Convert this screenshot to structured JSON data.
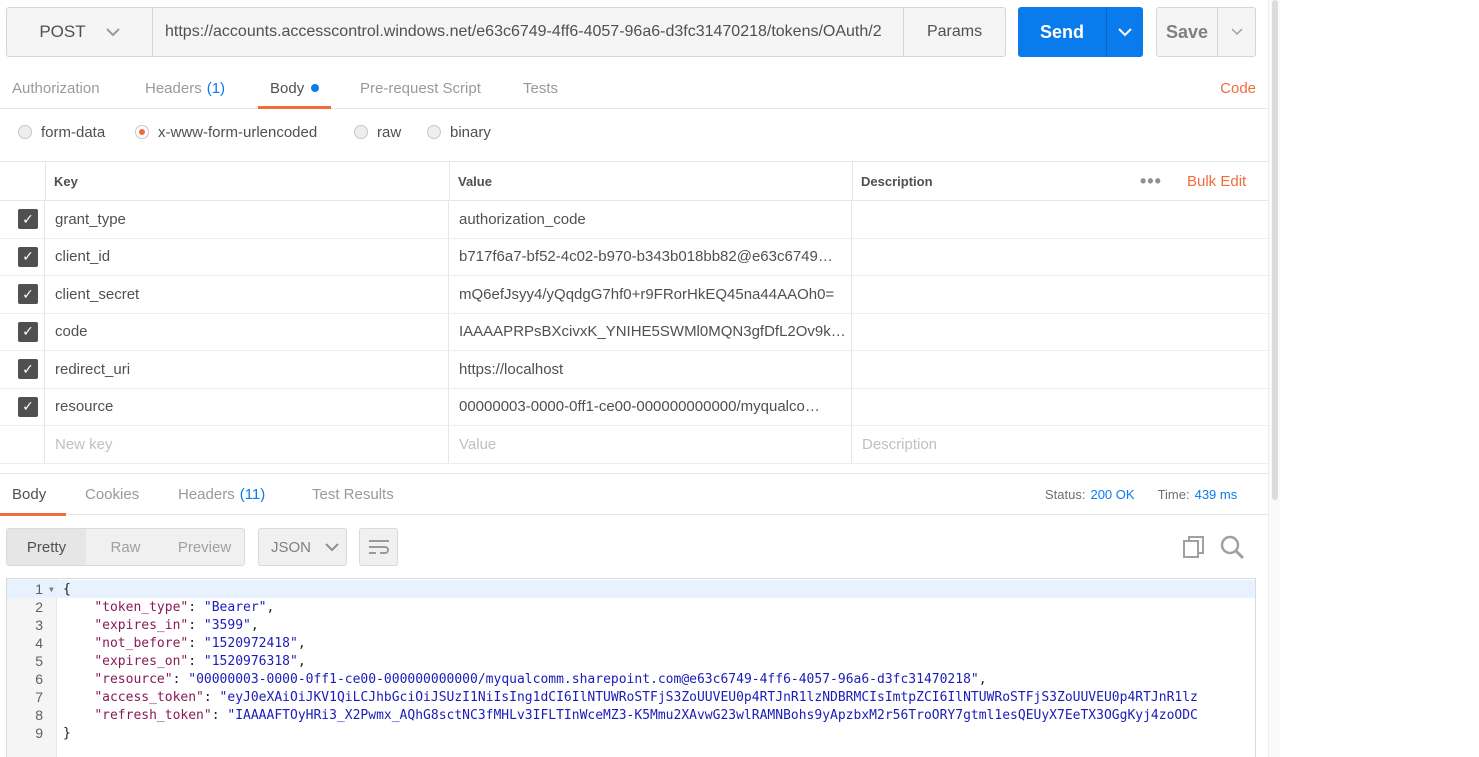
{
  "request": {
    "method": "POST",
    "url": "https://accounts.accesscontrol.windows.net/e63c6749-4ff6-4057-96a6-d3fc31470218/tokens/OAuth/2",
    "params_label": "Params",
    "send_label": "Send",
    "save_label": "Save"
  },
  "req_tabs": {
    "authorization": "Authorization",
    "headers": "Headers",
    "headers_count": "(1)",
    "body": "Body",
    "prerequest": "Pre-request Script",
    "tests": "Tests",
    "code": "Code"
  },
  "body_types": {
    "form_data": "form-data",
    "urlencoded": "x-www-form-urlencoded",
    "raw": "raw",
    "binary": "binary",
    "selected": "x-www-form-urlencoded"
  },
  "kv_table": {
    "headers": {
      "key": "Key",
      "value": "Value",
      "description": "Description"
    },
    "more": "•••",
    "bulk_edit": "Bulk Edit",
    "rows": [
      {
        "key": "grant_type",
        "value": "authorization_code",
        "checked": true
      },
      {
        "key": "client_id",
        "value": "b717f6a7-bf52-4c02-b970-b343b018bb82@e63c6749…",
        "checked": true
      },
      {
        "key": "client_secret",
        "value": "mQ6efJsyy4/yQqdgG7hf0+r9FRorHkEQ45na44AAOh0=",
        "checked": true
      },
      {
        "key": "code",
        "value": "IAAAAPRPsBXcivxK_YNIHE5SWMl0MQN3gfDfL2Ov9k…",
        "checked": true
      },
      {
        "key": "redirect_uri",
        "value": "https://localhost",
        "checked": true
      },
      {
        "key": "resource",
        "value": "00000003-0000-0ff1-ce00-000000000000/myqualco…",
        "checked": true
      }
    ],
    "new_row": {
      "key": "New key",
      "value": "Value",
      "description": "Description"
    }
  },
  "resp_tabs": {
    "body": "Body",
    "cookies": "Cookies",
    "headers": "Headers",
    "headers_count": "(11)",
    "test_results": "Test Results",
    "status_label": "Status:",
    "status_value": "200 OK",
    "time_label": "Time:",
    "time_value": "439 ms"
  },
  "resp_toolbar": {
    "pretty": "Pretty",
    "raw": "Raw",
    "preview": "Preview",
    "format": "JSON"
  },
  "editor": {
    "lines": [
      {
        "n": "1",
        "parts": [
          [
            "p",
            "{"
          ]
        ]
      },
      {
        "n": "2",
        "parts": [
          [
            "p",
            "    "
          ],
          [
            "k",
            "\"token_type\""
          ],
          [
            "p",
            ": "
          ],
          [
            "s",
            "\"Bearer\""
          ],
          [
            "p",
            ","
          ]
        ]
      },
      {
        "n": "3",
        "parts": [
          [
            "p",
            "    "
          ],
          [
            "k",
            "\"expires_in\""
          ],
          [
            "p",
            ": "
          ],
          [
            "s",
            "\"3599\""
          ],
          [
            "p",
            ","
          ]
        ]
      },
      {
        "n": "4",
        "parts": [
          [
            "p",
            "    "
          ],
          [
            "k",
            "\"not_before\""
          ],
          [
            "p",
            ": "
          ],
          [
            "s",
            "\"1520972418\""
          ],
          [
            "p",
            ","
          ]
        ]
      },
      {
        "n": "5",
        "parts": [
          [
            "p",
            "    "
          ],
          [
            "k",
            "\"expires_on\""
          ],
          [
            "p",
            ": "
          ],
          [
            "s",
            "\"1520976318\""
          ],
          [
            "p",
            ","
          ]
        ]
      },
      {
        "n": "6",
        "parts": [
          [
            "p",
            "    "
          ],
          [
            "k",
            "\"resource\""
          ],
          [
            "p",
            ": "
          ],
          [
            "s",
            "\"00000003-0000-0ff1-ce00-000000000000/myqualcomm.sharepoint.com@e63c6749-4ff6-4057-96a6-d3fc31470218\""
          ],
          [
            "p",
            ","
          ]
        ]
      },
      {
        "n": "7",
        "parts": [
          [
            "p",
            "    "
          ],
          [
            "k",
            "\"access_token\""
          ],
          [
            "p",
            ": "
          ],
          [
            "s",
            "\"eyJ0eXAiOiJKV1QiLCJhbGciOiJSUzI1NiIsIng1dCI6IlNTUWRoSTFjS3ZoUUVEU0p4RTJnR1lzNDBRMCIsImtpZCI6IlNTUWRoSTFjS3ZoUUVEU0p4RTJnR1lz"
          ]
        ]
      },
      {
        "n": "8",
        "parts": [
          [
            "p",
            "    "
          ],
          [
            "k",
            "\"refresh_token\""
          ],
          [
            "p",
            ": "
          ],
          [
            "s",
            "\"IAAAAFTOyHRi3_X2Pwmx_AQhG8sctNC3fMHLv3IFLTInWceMZ3-K5Mmu2XAvwG23wlRAMNBohs9yApzbxM2r56TroORY7gtml1esQEUyX7EeTX3OGgKyj4zoODC"
          ]
        ]
      },
      {
        "n": "9",
        "parts": [
          [
            "p",
            "}"
          ]
        ]
      }
    ]
  },
  "colors": {
    "accent": "#f26b3a",
    "primary": "#097bed",
    "json_key": "#8a1a56",
    "json_string": "#1c1cb8"
  }
}
